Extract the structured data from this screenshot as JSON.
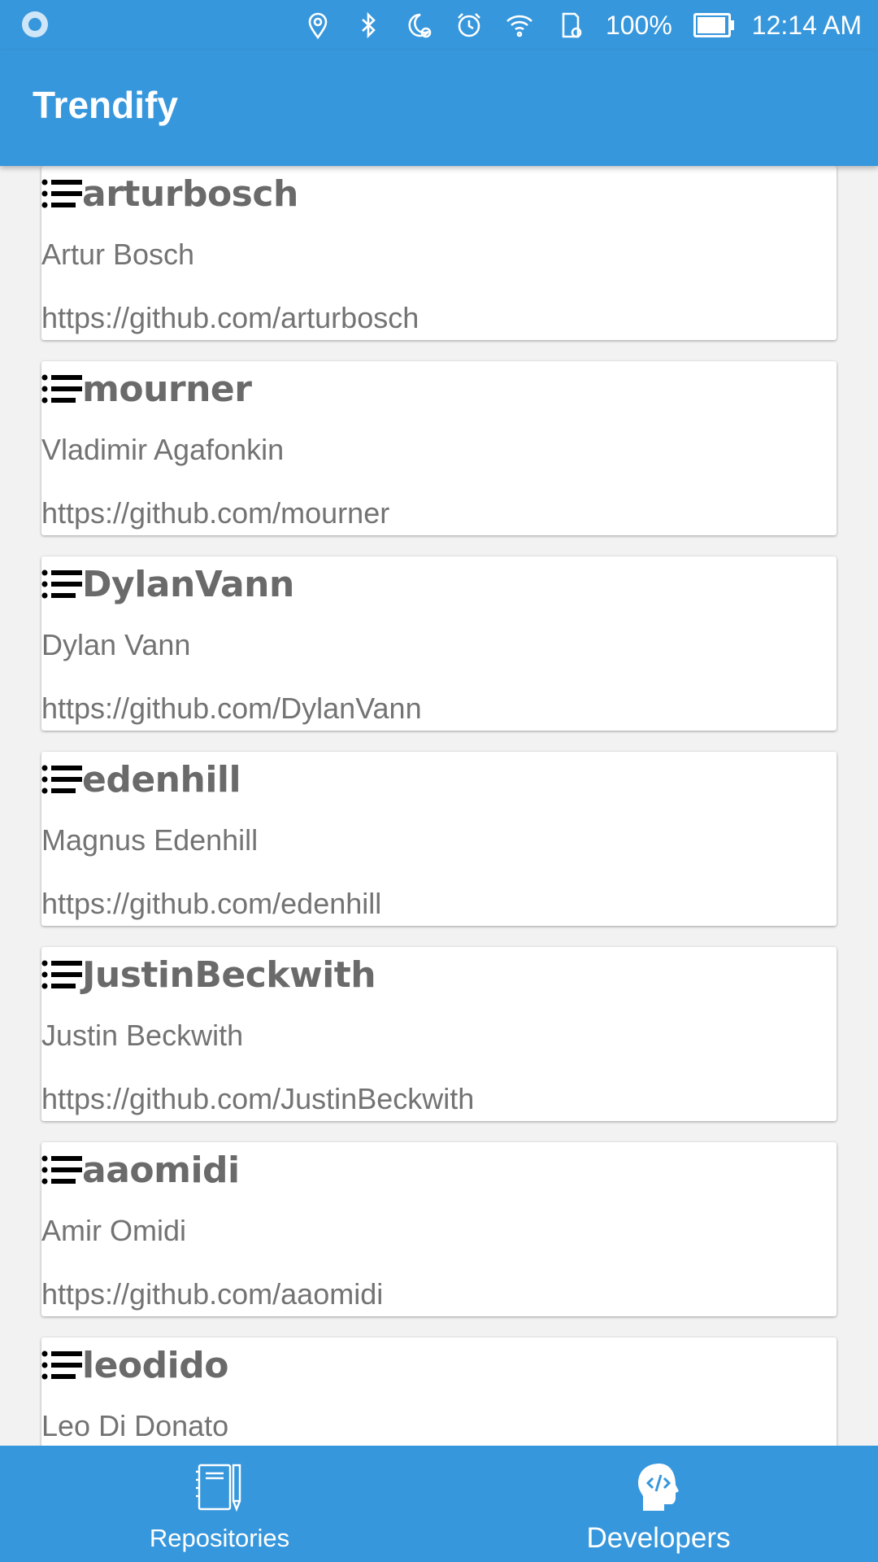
{
  "status_bar": {
    "battery": "100%",
    "time": "12:14 AM"
  },
  "app_bar": {
    "title": "Trendify"
  },
  "developers": [
    {
      "login": "arturbosch",
      "name": "Artur Bosch",
      "url": "https://github.com/arturbosch"
    },
    {
      "login": "mourner",
      "name": "Vladimir Agafonkin",
      "url": "https://github.com/mourner"
    },
    {
      "login": "DylanVann",
      "name": "Dylan Vann",
      "url": "https://github.com/DylanVann"
    },
    {
      "login": "edenhill",
      "name": "Magnus Edenhill",
      "url": "https://github.com/edenhill"
    },
    {
      "login": "JustinBeckwith",
      "name": "Justin Beckwith",
      "url": "https://github.com/JustinBeckwith"
    },
    {
      "login": "aaomidi",
      "name": "Amir Omidi",
      "url": "https://github.com/aaomidi"
    },
    {
      "login": "leodido",
      "name": "Leo Di Donato",
      "url": ""
    }
  ],
  "bottom_nav": {
    "items": [
      {
        "label": "Repositories",
        "icon": "notebook-pencil-icon",
        "selected": false
      },
      {
        "label": "Developers",
        "icon": "developer-head-icon",
        "selected": true
      }
    ]
  },
  "colors": {
    "primary": "#3797dc",
    "text_secondary": "#737373",
    "login_text": "#6a6a6a"
  }
}
